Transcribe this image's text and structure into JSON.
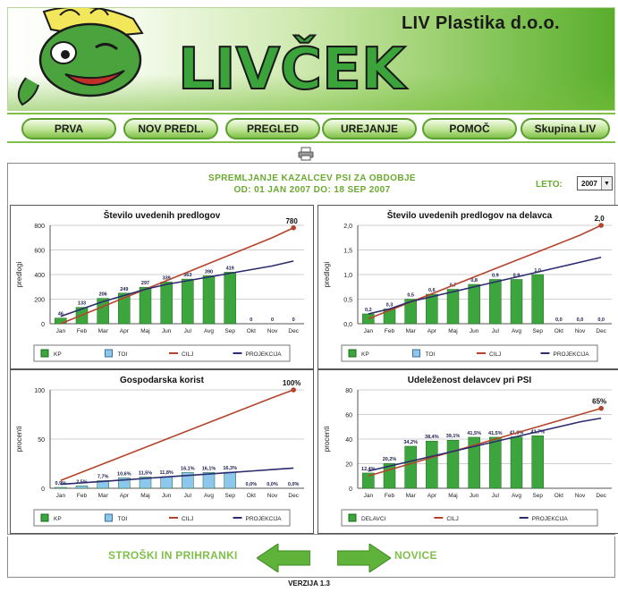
{
  "header": {
    "company": "LIV Plastika d.o.o.",
    "logo_text": "LIVČEK"
  },
  "nav": {
    "items": [
      "PRVA",
      "NOV PREDL.",
      "PREGLED",
      "UREJANJE",
      "POMOČ",
      "Skupina LIV"
    ]
  },
  "main": {
    "title_line1": "SPREMLJANJE KAZALCEV PSI ZA OBDOBJE",
    "title_line2": "OD: 01 JAN 2007   DO: 18 SEP 2007",
    "year_label": "LETO:",
    "year_value": "2007"
  },
  "footer": {
    "left_link": "STROŠKI IN PRIHRANKI",
    "right_link": "NOVICE",
    "version": "VERZIJA 1.3"
  },
  "colors": {
    "accent": "#7fc04a",
    "bar_green": "#3da53d",
    "bar_blue": "#8ec7ee",
    "target": "#b5442c",
    "projection": "#2b2b6e"
  },
  "chart_data": [
    {
      "type": "bar",
      "title": "Število uvedenih predlogov",
      "ylabel": "predlogi",
      "categories": [
        "Jan",
        "Feb",
        "Mar",
        "Apr",
        "Maj",
        "Jun",
        "Jul",
        "Avg",
        "Sep",
        "Okt",
        "Nov",
        "Dec"
      ],
      "yticks": [
        "0",
        "200",
        "400",
        "600",
        "800"
      ],
      "ylim": [
        0,
        800
      ],
      "series": [
        {
          "name": "KP",
          "values": [
            46,
            133,
            206,
            249,
            297,
            339,
            363,
            390,
            419,
            0,
            0,
            0
          ]
        },
        {
          "name": "CILJ",
          "values": [
            0,
            70,
            140,
            210,
            280,
            350,
            420,
            490,
            560,
            630,
            700,
            780
          ]
        },
        {
          "name": "PROJEKCIJA",
          "values": [
            60,
            120,
            180,
            230,
            280,
            320,
            350,
            380,
            410,
            440,
            470,
            510
          ]
        }
      ],
      "labels": [
        "46",
        "133",
        "206",
        "249",
        "297",
        "339",
        "363",
        "390",
        "419",
        "0",
        "0",
        "0"
      ],
      "target_label": "780",
      "legend": [
        "KP",
        "TOI",
        "CILJ",
        "PROJEKCIJA"
      ]
    },
    {
      "type": "bar",
      "title": "Število uvedenih predlogov na delavca",
      "ylabel": "predlogi",
      "categories": [
        "Jan",
        "Feb",
        "Mar",
        "Apr",
        "Maj",
        "Jun",
        "Jul",
        "Avg",
        "Sep",
        "Okt",
        "Nov",
        "Dec"
      ],
      "yticks": [
        "0,0",
        "0,5",
        "1,0",
        "1,5",
        "2,0"
      ],
      "ylim": [
        0,
        2
      ],
      "series": [
        {
          "name": "KP",
          "values": [
            0.2,
            0.3,
            0.5,
            0.6,
            0.7,
            0.8,
            0.9,
            0.9,
            1.0,
            0,
            0,
            0
          ]
        },
        {
          "name": "CILJ",
          "values": [
            0.1,
            0.27,
            0.44,
            0.61,
            0.78,
            0.95,
            1.12,
            1.29,
            1.46,
            1.63,
            1.8,
            2.0
          ]
        },
        {
          "name": "PROJEKCIJA",
          "values": [
            0.2,
            0.3,
            0.45,
            0.55,
            0.65,
            0.75,
            0.85,
            0.95,
            1.05,
            1.15,
            1.25,
            1.35
          ]
        }
      ],
      "labels": [
        "0,2",
        "0,3",
        "0,5",
        "0,6",
        "0,7",
        "0,8",
        "0,9",
        "0,9",
        "1,0",
        "0,0",
        "0,0",
        "0,0"
      ],
      "target_label": "2,0",
      "legend": [
        "KP",
        "TOI",
        "CILJ",
        "PROJEKCIJA"
      ]
    },
    {
      "type": "bar",
      "title": "Gospodarska korist",
      "ylabel": "procenti",
      "categories": [
        "Jan",
        "Feb",
        "Mar",
        "Apr",
        "Maj",
        "Jun",
        "Jul",
        "Avg",
        "Sep",
        "Okt",
        "Nov",
        "Dec"
      ],
      "yticks": [
        "0",
        "50",
        "100"
      ],
      "ylim": [
        0,
        100
      ],
      "series": [
        {
          "name": "TOI",
          "values": [
            0.9,
            2.5,
            7.7,
            10.6,
            11.5,
            11.8,
            16.1,
            16.1,
            16.3,
            0,
            0,
            0
          ]
        },
        {
          "name": "CILJ",
          "values": [
            8,
            16.4,
            24.8,
            33.2,
            41.6,
            50,
            58.4,
            66.8,
            75.2,
            83.6,
            92,
            100
          ]
        },
        {
          "name": "PROJEKCIJA",
          "values": [
            4,
            5.5,
            7,
            8.5,
            10,
            11.5,
            13,
            14.5,
            16,
            17.5,
            19,
            20.5
          ]
        }
      ],
      "labels": [
        "0,9%",
        "2,5%",
        "7,7%",
        "10,6%",
        "11,5%",
        "11,8%",
        "16,1%",
        "16,1%",
        "16,3%",
        "0,0%",
        "0,0%",
        "0,0%"
      ],
      "target_label": "100%",
      "legend": [
        "KP",
        "TOI",
        "CILJ",
        "PROJEKCIJA"
      ]
    },
    {
      "type": "bar",
      "title": "Udeleženost delavcev pri PSI",
      "ylabel": "procenti",
      "categories": [
        "Jan",
        "Feb",
        "Mar",
        "Apr",
        "Maj",
        "Jun",
        "Jul",
        "Avg",
        "Sep",
        "Okt",
        "Nov",
        "Dec"
      ],
      "yticks": [
        "0",
        "20",
        "40",
        "60",
        "80"
      ],
      "ylim": [
        0,
        80
      ],
      "series": [
        {
          "name": "DELAVCI",
          "values": [
            12.4,
            20.2,
            34.2,
            38.4,
            39.1,
            41.5,
            41.5,
            41.8,
            42.7,
            0,
            0,
            0
          ]
        },
        {
          "name": "CILJ",
          "values": [
            10,
            15,
            20,
            25,
            30,
            35,
            40,
            45,
            50,
            55,
            60,
            65
          ]
        },
        {
          "name": "PROJEKCIJA",
          "values": [
            14,
            18,
            22,
            26,
            30,
            34,
            38,
            42,
            46,
            50,
            54,
            57
          ]
        }
      ],
      "labels": [
        "12,4%",
        "20,2%",
        "34,2%",
        "38,4%",
        "39,1%",
        "41,5%",
        "41,5%",
        "41,8%",
        "42,7%",
        "",
        "",
        ""
      ],
      "target_label": "65%",
      "legend": [
        "DELAVCI",
        "CILJ",
        "PROJEKCIJA"
      ]
    }
  ]
}
